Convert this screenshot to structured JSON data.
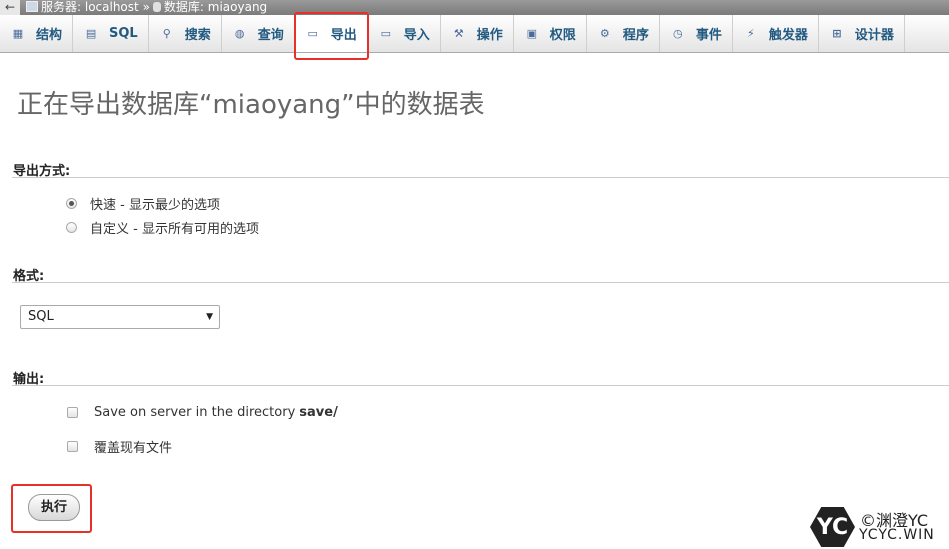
{
  "breadcrumb": {
    "back": "←",
    "server_label": "服务器: localhost",
    "separator": "»",
    "db_label": "数据库: miaoyang"
  },
  "tabs": [
    {
      "label": "结构",
      "icon": "structure-icon",
      "glyph": "▦"
    },
    {
      "label": "SQL",
      "icon": "sql-icon",
      "glyph": "▤"
    },
    {
      "label": "搜索",
      "icon": "search-icon",
      "glyph": "⚲"
    },
    {
      "label": "查询",
      "icon": "query-icon",
      "glyph": "◍"
    },
    {
      "label": "导出",
      "icon": "export-icon",
      "glyph": "▭"
    },
    {
      "label": "导入",
      "icon": "import-icon",
      "glyph": "▭"
    },
    {
      "label": "操作",
      "icon": "wrench-icon",
      "glyph": "⚒"
    },
    {
      "label": "权限",
      "icon": "privileges-icon",
      "glyph": "▣"
    },
    {
      "label": "程序",
      "icon": "routines-icon",
      "glyph": "⚙"
    },
    {
      "label": "事件",
      "icon": "clock-icon",
      "glyph": "◷"
    },
    {
      "label": "触发器",
      "icon": "triggers-icon",
      "glyph": "⚡"
    },
    {
      "label": "设计器",
      "icon": "designer-icon",
      "glyph": "⊞"
    }
  ],
  "page_title": "正在导出数据库“miaoyang”中的数据表",
  "export_method": {
    "label": "导出方式:",
    "options": [
      {
        "label": "快速 - 显示最少的选项",
        "checked": true
      },
      {
        "label": "自定义 - 显示所有可用的选项",
        "checked": false
      }
    ]
  },
  "format": {
    "label": "格式:",
    "selected": "SQL",
    "arrow": "▼"
  },
  "output": {
    "label": "输出:",
    "save_on_server": "Save on server in the directory",
    "save_dir": "save/",
    "overwrite": "覆盖现有文件"
  },
  "go_button": "执行",
  "watermark": {
    "logo": "YC",
    "line1": "©渊澄YC",
    "line2": "YCYC.WIN"
  },
  "colors": {
    "highlight": "#e8302a",
    "tab_text": "#235a81"
  }
}
